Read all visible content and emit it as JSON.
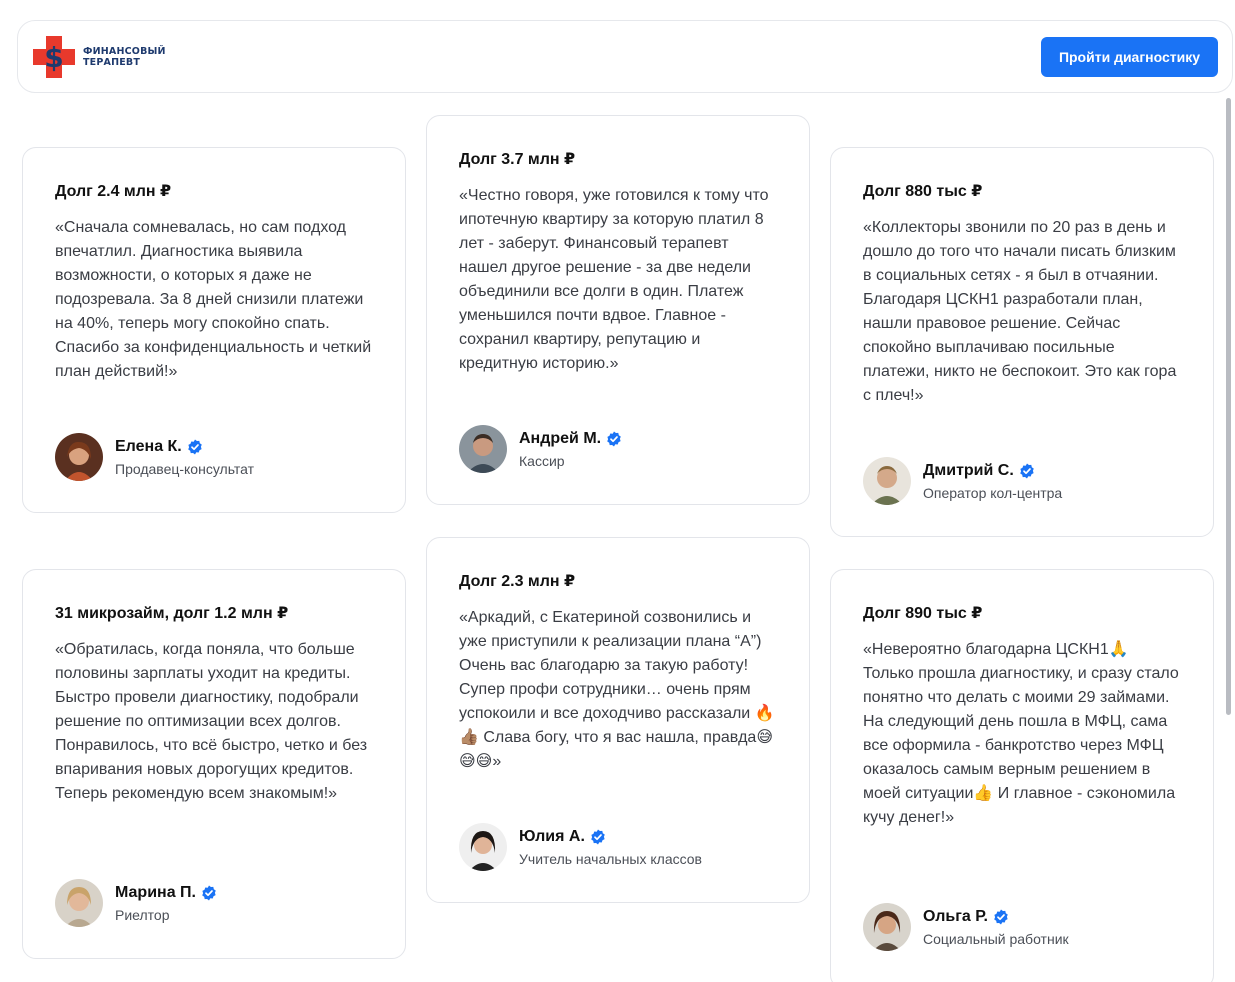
{
  "header": {
    "logo_line1": "ФИНАНСОВЫЙ",
    "logo_line2": "ТЕРАПЕВТ",
    "cta_label": "Пройти диагностику"
  },
  "colors": {
    "accent": "#1a73f5",
    "logo_red": "#e8392c",
    "verified": "#1a73f5"
  },
  "reviews": [
    {
      "title": "Долг 2.4 млн ₽",
      "quote": "«Сначала сомневалась, но сам подход впечатлил. Диагностика выявила возможности, о которых я даже не подозревала. За 8 дней снизили платежи на 40%, теперь могу спокойно спать. Спасибо за конфиденциальность и четкий план действий!»",
      "name": "Елена К.",
      "role": "Продавец-консультат",
      "avatar_icon": "woman-portrait"
    },
    {
      "title": "Долг 3.7 млн ₽",
      "quote": "«Честно говоря, уже готовился к тому что ипотечную квартиру за которую платил 8 лет - заберут. Финансовый терапевт нашел другое решение - за две недели объединили все долги в один. Платеж уменьшился почти вдвое. Главное - сохранил квартиру, репутацию и кредитную историю.»",
      "name": "Андрей М.",
      "role": "Кассир",
      "avatar_icon": "man-portrait"
    },
    {
      "title": "Долг 880 тыс ₽",
      "quote": "«Коллекторы звонили по 20 раз в день и дошло до того что начали писать близким в социальных сетях - я был в отчаянии. Благодаря ЦСКН1 разработали план, нашли правовое решение. Сейчас спокойно выплачиваю посильные платежи, никто не беспокоит. Это как гора с плеч!»",
      "name": "Дмитрий С.",
      "role": "Оператор кол-центра",
      "avatar_icon": "man-portrait"
    },
    {
      "title": "31 микрозайм, долг 1.2 млн ₽",
      "quote": "«Обратилась, когда поняла, что больше половины зарплаты уходит на кредиты. Быстро провели диагностику, подобрали решение по оптимизации всех долгов. Понравилось, что всё быстро, четко и без впаривания новых дорогущих кредитов. Теперь рекомендую всем знакомым!»",
      "name": "Марина П.",
      "role": "Риелтор",
      "avatar_icon": "woman-portrait"
    },
    {
      "title": "Долг 2.3 млн ₽",
      "quote": "«Аркадий, с Екатериной созвонились и уже приступили к реализации плана “А”) Очень вас благодарю за такую работу! Супер профи сотрудники… очень прям успокоили и все доходчиво рассказали 🔥👍🏽 Слава богу, что я вас нашла, правда😅😅😅»",
      "name": "Юлия А.",
      "role": "Учитель начальных классов",
      "avatar_icon": "woman-portrait"
    },
    {
      "title": "Долг 890 тыс ₽",
      "quote": "«Невероятно благодарна ЦСКН1🙏 Только прошла диагностику, и сразу стало понятно что делать с моими 29 займами. На следующий день пошла в МФЦ, сама все оформила - банкротство через МФЦ оказалось самым верным решением в моей ситуации👍 И главное - сэкономила кучу денег!»",
      "name": "Ольга Р.",
      "role": "Социальный работник",
      "avatar_icon": "woman-portrait"
    }
  ]
}
